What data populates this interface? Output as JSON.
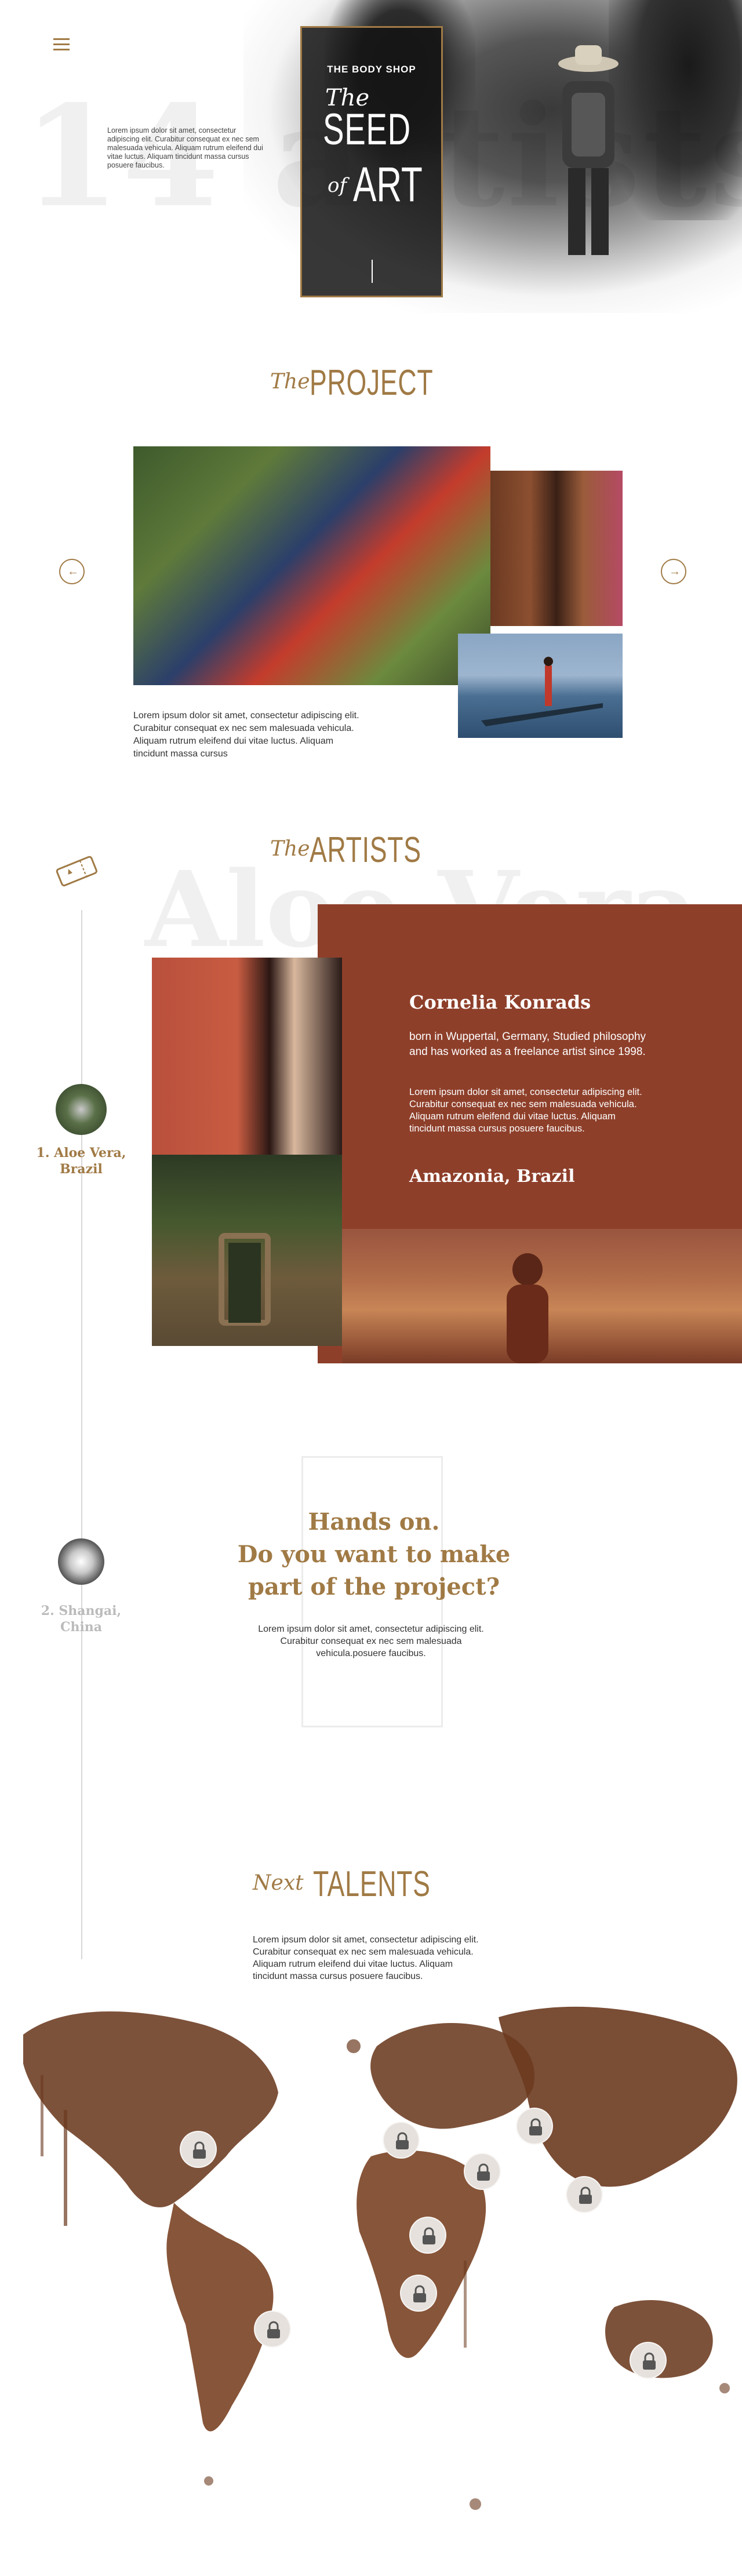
{
  "hero": {
    "ghost_text": "14 artists",
    "intro_text": "Lorem ipsum dolor sit amet, consectetur adipiscing elit. Curabitur consequat ex nec sem malesuada vehicula. Aliquam rutrum eleifend dui vitae luctus. Aliquam tincidunt massa cursus posuere faucibus.",
    "logo": {
      "brand": "THE BODY SHOP",
      "the": "The",
      "seed": "SEED",
      "of": "of",
      "art": "ART"
    },
    "menu_icon": "hamburger-icon"
  },
  "project": {
    "heading_pre": "The",
    "heading_main": "PROJECT",
    "text": "Lorem ipsum dolor sit amet, consectetur adipiscing elit. Curabitur consequat ex nec sem malesuada vehicula. Aliquam rutrum eleifend dui vitae luctus. Aliquam tincidunt massa cursus",
    "prev_icon": "arrow-left-icon",
    "next_icon": "arrow-right-icon"
  },
  "artists": {
    "heading_pre": "The",
    "heading_main": "ARTISTS",
    "ghost_text": "Aloe Vera",
    "timeline": [
      {
        "label_line1": "1. Aloe Vera,",
        "label_line2": "Brazil"
      },
      {
        "label_line1": "2. Shangai,",
        "label_line2": "China"
      }
    ],
    "featured": {
      "name": "Cornelia Konrads",
      "bio": "born in Wuppertal, Germany, Studied philosophy and has worked as a freelance artist since 1998.",
      "text": "Lorem ipsum dolor sit amet, consectetur adipiscing elit. Curabitur consequat ex nec sem malesuada vehicula. Aliquam rutrum eleifend dui vitae luctus. Aliquam tincidunt massa cursus posuere faucibus.",
      "location": "Amazonia, Brazil"
    }
  },
  "cta": {
    "title_line1": "Hands on.",
    "title_line2": "Do you want to make",
    "title_line3": "part of the project?",
    "text": "Lorem ipsum dolor sit amet, consectetur adipiscing elit. Curabitur consequat ex nec sem malesuada vehicula.posuere faucibus."
  },
  "talents": {
    "heading_pre": "Next",
    "heading_main": "TALENTS",
    "text": "Lorem ipsum dolor sit amet, consectetur adipiscing elit. Curabitur consequat ex nec sem malesuada vehicula. Aliquam rutrum eleifend dui vitae luctus. Aliquam tincidunt massa cursus posuere faucibus.",
    "pin_icon": "lock-icon",
    "locked_regions": 9
  },
  "colors": {
    "accent": "#a07a45",
    "artist_panel": "#8e3f2a",
    "map_paint": "#6b3a1f"
  }
}
